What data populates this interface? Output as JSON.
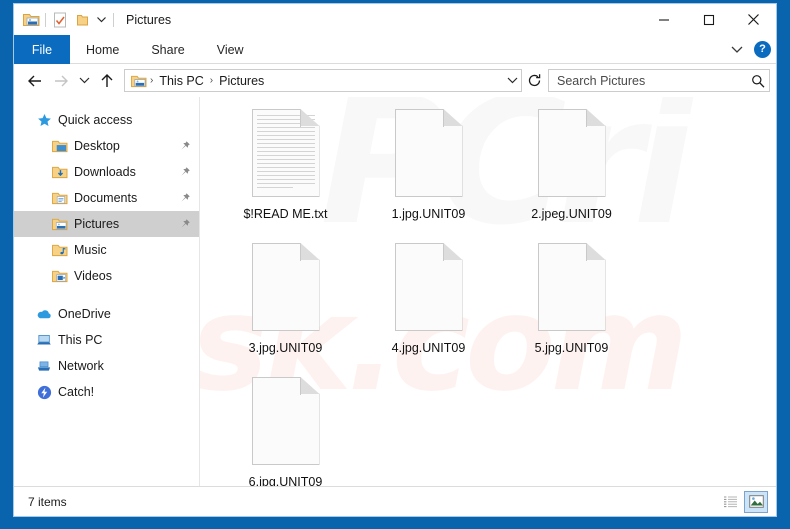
{
  "window": {
    "title": "Pictures",
    "quick_access_toolbar": [
      {
        "name": "folder-properties-icon",
        "label": "Properties"
      },
      {
        "name": "new-folder-icon",
        "label": "New folder"
      }
    ],
    "controls": {
      "minimize": "─",
      "maximize": "□",
      "close": "✕"
    }
  },
  "ribbon": {
    "tabs": [
      {
        "label": "File",
        "active": true
      },
      {
        "label": "Home",
        "active": false
      },
      {
        "label": "Share",
        "active": false
      },
      {
        "label": "View",
        "active": false
      }
    ],
    "collapse_label": "⌄",
    "help_label": "?"
  },
  "addressbar": {
    "back_label": "←",
    "forward_label": "→",
    "recent_label": "⌄",
    "up_label": "↑",
    "crumbs": [
      "This PC",
      "Pictures"
    ],
    "separator": "›",
    "dropdown_label": "⌄",
    "refresh_label": "↻"
  },
  "search": {
    "placeholder": "Search Pictures",
    "value": ""
  },
  "sidebar": {
    "items": [
      {
        "label": "Quick access",
        "icon": "star-icon",
        "level": 0,
        "pinned": false,
        "selected": false
      },
      {
        "label": "Desktop",
        "icon": "desktop-folder-icon",
        "level": 1,
        "pinned": true,
        "selected": false
      },
      {
        "label": "Downloads",
        "icon": "downloads-folder-icon",
        "level": 1,
        "pinned": true,
        "selected": false
      },
      {
        "label": "Documents",
        "icon": "documents-folder-icon",
        "level": 1,
        "pinned": true,
        "selected": false
      },
      {
        "label": "Pictures",
        "icon": "pictures-folder-icon",
        "level": 1,
        "pinned": true,
        "selected": true
      },
      {
        "label": "Music",
        "icon": "music-folder-icon",
        "level": 1,
        "pinned": false,
        "selected": false
      },
      {
        "label": "Videos",
        "icon": "videos-folder-icon",
        "level": 1,
        "pinned": false,
        "selected": false
      },
      {
        "label": "OneDrive",
        "icon": "onedrive-cloud-icon",
        "level": 0,
        "pinned": false,
        "selected": false
      },
      {
        "label": "This PC",
        "icon": "this-pc-icon",
        "level": 0,
        "pinned": false,
        "selected": false
      },
      {
        "label": "Network",
        "icon": "network-icon",
        "level": 0,
        "pinned": false,
        "selected": false
      },
      {
        "label": "Catch!",
        "icon": "catch-app-icon",
        "level": 0,
        "pinned": false,
        "selected": false
      }
    ]
  },
  "files": [
    {
      "name": "$!READ ME.txt",
      "type": "text"
    },
    {
      "name": "1.jpg.UNIT09",
      "type": "blank"
    },
    {
      "name": "2.jpeg.UNIT09",
      "type": "blank"
    },
    {
      "name": "3.jpg.UNIT09",
      "type": "blank"
    },
    {
      "name": "4.jpg.UNIT09",
      "type": "blank"
    },
    {
      "name": "5.jpg.UNIT09",
      "type": "blank"
    },
    {
      "name": "6.jpg.UNIT09",
      "type": "blank"
    }
  ],
  "statusbar": {
    "item_count": "7 items",
    "views": [
      {
        "name": "details-view-button",
        "active": false
      },
      {
        "name": "large-icons-view-button",
        "active": true
      }
    ]
  },
  "watermark": {
    "grey_text": "PCri",
    "pink_text": "risk.com"
  },
  "colors": {
    "frame_blue": "#0a64ad",
    "tab_blue": "#0b6cbf",
    "selection_grey": "#cfcfcf",
    "view_active": "#cce4f7"
  }
}
